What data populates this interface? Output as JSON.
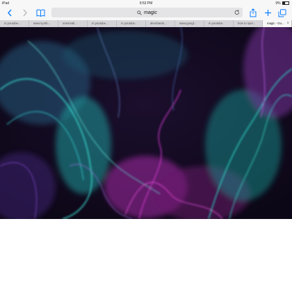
{
  "status_bar": {
    "device": "iPad",
    "time": "9:53 PM",
    "battery": "9%"
  },
  "toolbar": {
    "back_icon": "chevron-left",
    "forward_icon": "chevron-right",
    "bookmarks_icon": "open-book",
    "share_icon": "share-box",
    "new_tab_icon": "plus",
    "tabs_icon": "overlapping-squares",
    "accent_color": "#0a7cff"
  },
  "address_bar": {
    "text": "magic",
    "search_icon": "magnifier",
    "reload_icon": "circular-arrow"
  },
  "tabs": [
    {
      "label": "m.youtube...",
      "active": false
    },
    {
      "label": "www.symb...",
      "active": false
    },
    {
      "label": "onesmall...",
      "active": false
    },
    {
      "label": "m.youtube...",
      "active": false
    },
    {
      "label": "m.youtube...",
      "active": false
    },
    {
      "label": "alexrbardo...",
      "active": false
    },
    {
      "label": "www.googl...",
      "active": false
    },
    {
      "label": "m.youtube...",
      "active": false
    },
    {
      "label": "how to spel...",
      "active": false
    },
    {
      "label": "magic - Go...",
      "active": true
    }
  ],
  "hero": {
    "description_colors": [
      "#120a1e",
      "#1fb9b0",
      "#c02fb9",
      "#5a3aa8"
    ]
  }
}
